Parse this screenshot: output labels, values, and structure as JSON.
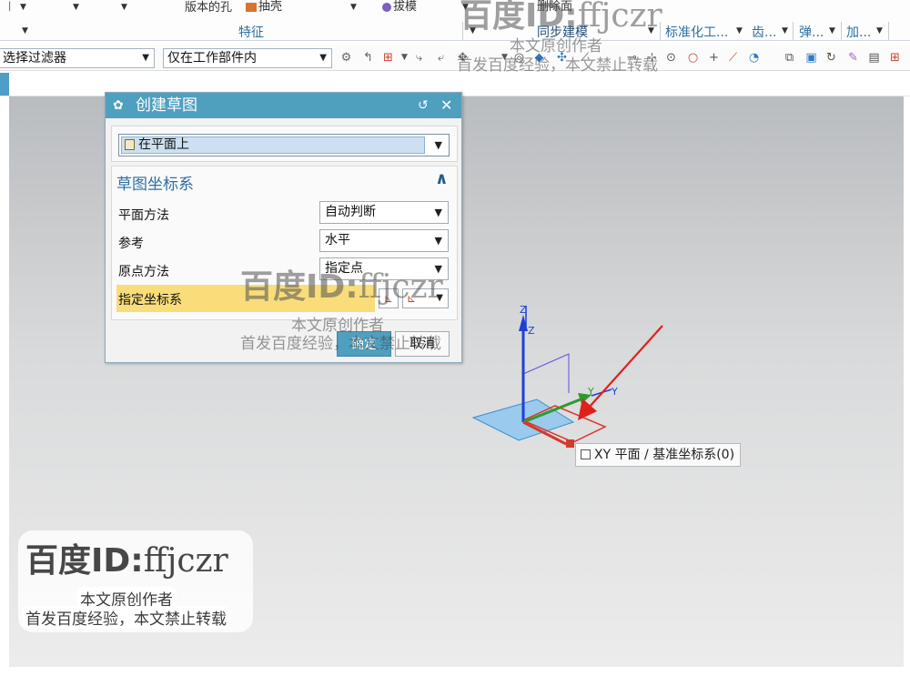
{
  "ribbon": {
    "top_items": [
      "版本的孔",
      "抽壳",
      "拔模",
      "删除面"
    ],
    "group_feature": "特征",
    "group_sync": "同步建模",
    "group_std": "标准化工...",
    "group_gear": "齿...",
    "group_spring": "弹...",
    "group_add": "加..."
  },
  "filterbar": {
    "type_filter": "选择过滤器",
    "scope_filter": "仅在工作部件内"
  },
  "dialog": {
    "title": "创建草图",
    "sketch_type": "在平面上",
    "section_title": "草图坐标系",
    "rows": [
      {
        "label": "平面方法",
        "value": "自动判断"
      },
      {
        "label": "参考",
        "value": "水平"
      },
      {
        "label": "原点方法",
        "value": "指定点"
      }
    ],
    "csys_label": "指定坐标系",
    "ok_label": "确定",
    "cancel_label": "取消"
  },
  "viewport": {
    "axis_z1": "Z",
    "axis_z2": "Z",
    "axis_y1": "Y",
    "axis_y2": "Y",
    "tooltip": "XY 平面 / 基准坐标系(0)"
  },
  "watermark": {
    "brand": "百度ID:",
    "id": "ffjczr",
    "line1": "本文原创作者",
    "line2": "首发百度经验，本文禁止转载"
  },
  "colors": {
    "dialog_title_bg": "#4f9fbf",
    "highlight_row": "#f9dd7a",
    "axis_z": "#1f3fd6",
    "axis_y": "#2e9a2e",
    "axis_x": "#d23a2a",
    "arrow": "#e0201c"
  }
}
